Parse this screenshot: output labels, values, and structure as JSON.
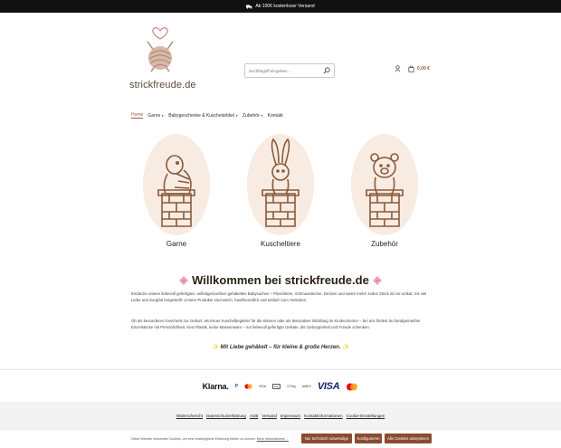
{
  "topbar": {
    "text": "Ab 100€ kostenloser Versand",
    "icon": "truck-icon"
  },
  "header": {
    "logo_text": "strickfreude.de",
    "search_placeholder": "Suchbegriff eingeben ...",
    "cart_total": "0,00 €"
  },
  "nav": {
    "items": [
      {
        "label": "Home",
        "caret": ""
      },
      {
        "label": "Garne",
        "caret": "▼"
      },
      {
        "label": "Babygeschenke & Kuschelartikel",
        "caret": "▼"
      },
      {
        "label": "Zubehör",
        "caret": "▼"
      },
      {
        "label": "Kontakt",
        "caret": ""
      }
    ]
  },
  "categories": [
    {
      "label": "Garne",
      "icon": "turtle-icon"
    },
    {
      "label": "Kuscheltiere",
      "icon": "bunny-icon"
    },
    {
      "label": "Zubehör",
      "icon": "bear-icon"
    }
  ],
  "welcome": {
    "title": "Willkommen bei strickfreude.de",
    "p1": "Entdecke unsere liebevoll gefertigten, selbstgemachten gehäkelten Babysachen – Plüschtiere, Schmusetücher, Decken und vieles mehr! Jedes Stück ist ein Unikat, mit viel Liebe und Sorgfalt hergestellt. Unsere Produkte sind weich, hautfreundlich und einfach zum Verlieben.",
    "p2": "Ob als besonderes Geschenk zur Geburt, als treuer Kuschelbegleiter für die Kleinen oder als dekorativer Blickfang im Kinderzimmer – bei uns findest du handgemachte Einzelstücke mit Persönlichkeit. Kein Plastik, keine Massenware – nur liebevoll gefertigte Unikate, die Geborgenheit und Freude schenken.",
    "tagline": "Mit Liebe gehäkelt – für kleine & große Herzen."
  },
  "payments": {
    "klarna": "Klarna.",
    "paypal": "P",
    "visa_small": "VISA",
    "applepay": "Pay",
    "gpay": "G Pay",
    "amex": "AMEX",
    "visa": "VISA"
  },
  "footer": {
    "links": [
      "Widerrufsrecht",
      "Datenschutzerklärung",
      "AGB",
      "Versand",
      "Impressum",
      "Kontaktinformationen",
      "Cookie-Einstellungen"
    ]
  },
  "cookies": {
    "text": "Diese Website verwendet Cookies, um eine bestmögliche Erfahrung bieten zu können.",
    "more": "Mehr Informationen ...",
    "btn_necessary": "Nur technisch notwendige",
    "btn_configure": "Konfigurieren",
    "btn_accept": "Alle Cookies akzeptieren"
  },
  "colors": {
    "accent": "#8a4b30",
    "circle_bg": "#f8ebe2",
    "line": "#8a5a3a"
  }
}
